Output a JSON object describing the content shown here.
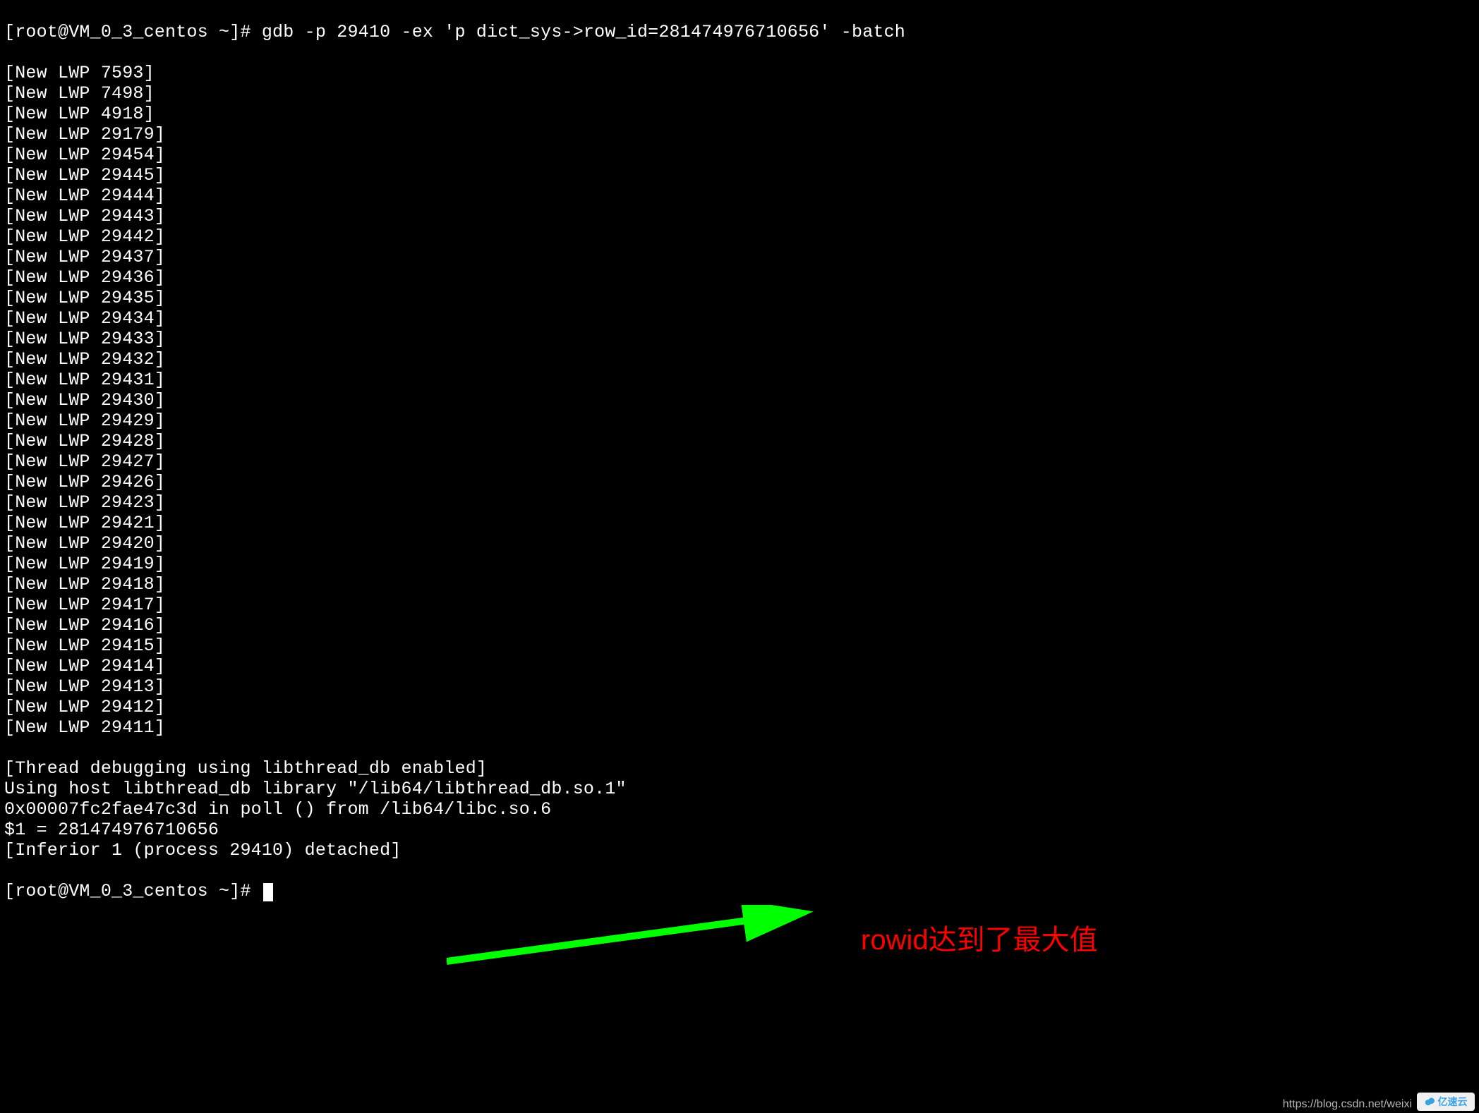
{
  "terminal": {
    "prompt1": "[root@VM_0_3_centos ~]# ",
    "command1": "gdb -p 29410 -ex 'p dict_sys->row_id=281474976710656' -batch",
    "lwp": [
      "[New LWP 7593]",
      "[New LWP 7498]",
      "[New LWP 4918]",
      "[New LWP 29179]",
      "[New LWP 29454]",
      "[New LWP 29445]",
      "[New LWP 29444]",
      "[New LWP 29443]",
      "[New LWP 29442]",
      "[New LWP 29437]",
      "[New LWP 29436]",
      "[New LWP 29435]",
      "[New LWP 29434]",
      "[New LWP 29433]",
      "[New LWP 29432]",
      "[New LWP 29431]",
      "[New LWP 29430]",
      "[New LWP 29429]",
      "[New LWP 29428]",
      "[New LWP 29427]",
      "[New LWP 29426]",
      "[New LWP 29423]",
      "[New LWP 29421]",
      "[New LWP 29420]",
      "[New LWP 29419]",
      "[New LWP 29418]",
      "[New LWP 29417]",
      "[New LWP 29416]",
      "[New LWP 29415]",
      "[New LWP 29414]",
      "[New LWP 29413]",
      "[New LWP 29412]",
      "[New LWP 29411]"
    ],
    "tail": [
      "[Thread debugging using libthread_db enabled]",
      "Using host libthread_db library \"/lib64/libthread_db.so.1\"",
      "0x00007fc2fae47c3d in poll () from /lib64/libc.so.6",
      "$1 = 281474976710656",
      "[Inferior 1 (process 29410) detached]"
    ],
    "prompt2": "[root@VM_0_3_centos ~]# "
  },
  "annotation": "rowid达到了最大值",
  "watermark": {
    "url": "https://blog.csdn.net/weixi",
    "logo": "亿速云"
  },
  "arrow_color": "#00ff00",
  "annotation_color": "#ff0000"
}
